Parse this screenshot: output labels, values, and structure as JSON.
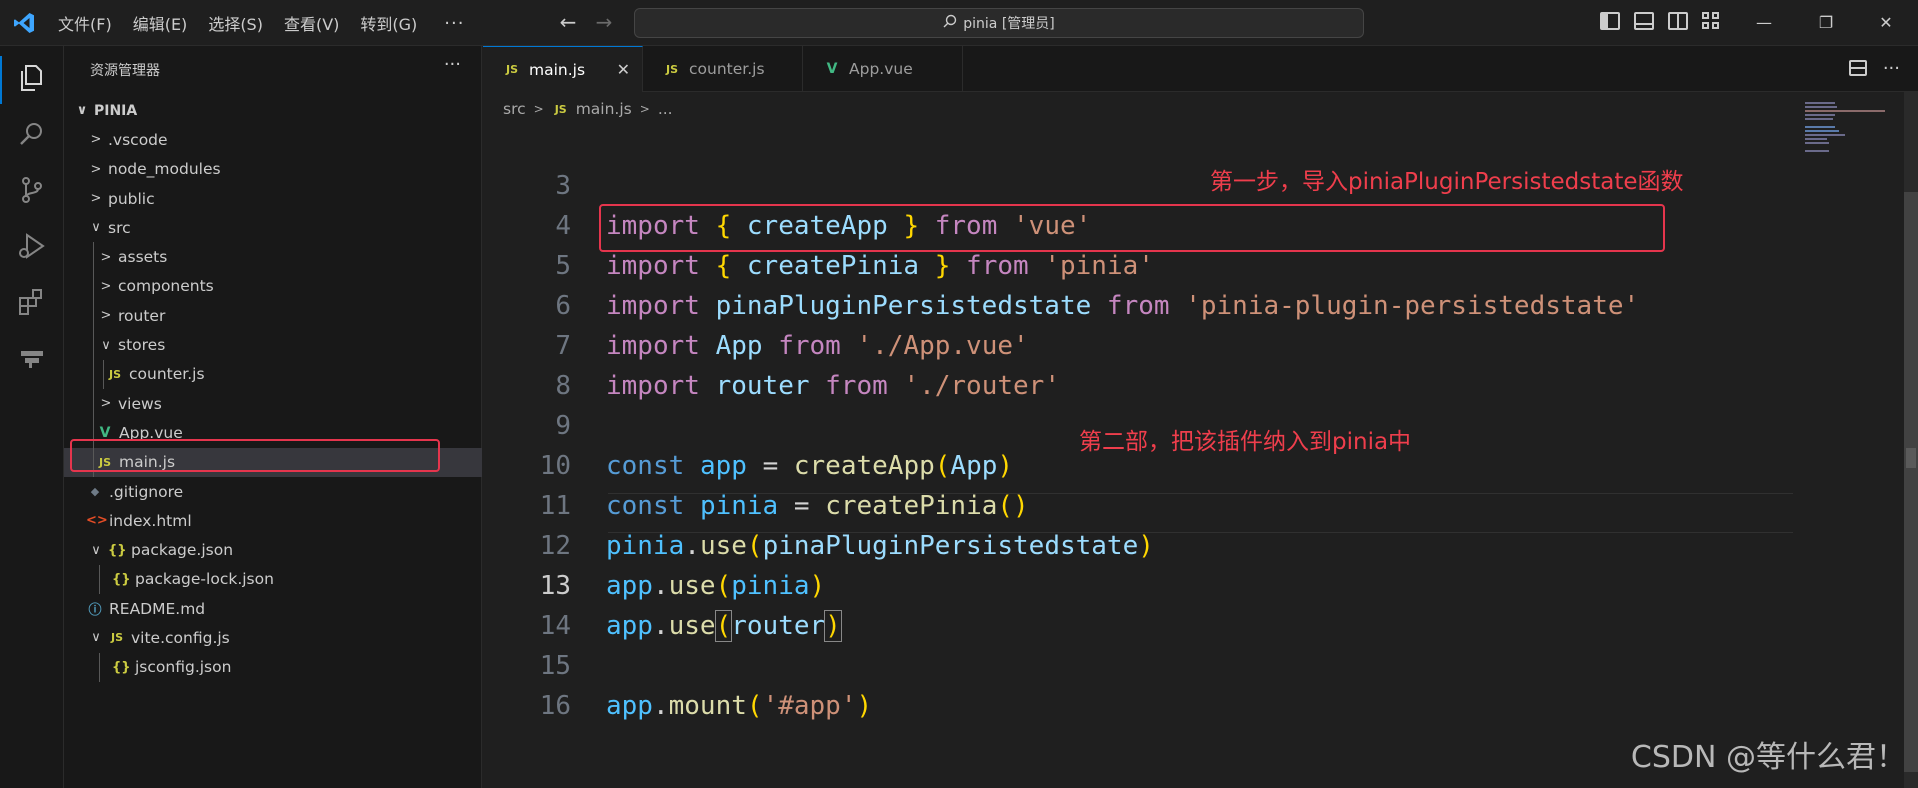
{
  "titlebar": {
    "menus": [
      "文件(F)",
      "编辑(E)",
      "选择(S)",
      "查看(V)",
      "转到(G)"
    ],
    "more": "···",
    "search_text": "pinia [管理员]",
    "back_icon": "arrow-left-icon",
    "forward_icon": "arrow-right-icon",
    "minimize": "—",
    "restore": "❐",
    "close": "✕"
  },
  "explorer": {
    "title": "资源管理器",
    "more": "···",
    "items": [
      {
        "label": "PINIA",
        "chev": "∨",
        "icon": ""
      },
      {
        "label": ".vscode",
        "chev": ">",
        "icon": ""
      },
      {
        "label": "node_modules",
        "chev": ">",
        "icon": ""
      },
      {
        "label": "public",
        "chev": ">",
        "icon": ""
      },
      {
        "label": "src",
        "chev": "∨",
        "icon": ""
      },
      {
        "label": "assets",
        "chev": ">",
        "icon": ""
      },
      {
        "label": "components",
        "chev": ">",
        "icon": ""
      },
      {
        "label": "router",
        "chev": ">",
        "icon": ""
      },
      {
        "label": "stores",
        "chev": "∨",
        "icon": ""
      },
      {
        "label": "counter.js",
        "chev": "",
        "icon": "JS"
      },
      {
        "label": "views",
        "chev": ">",
        "icon": ""
      },
      {
        "label": "App.vue",
        "chev": "",
        "icon": "V"
      },
      {
        "label": "main.js",
        "chev": "",
        "icon": "JS"
      },
      {
        "label": ".gitignore",
        "chev": "",
        "icon": "◆"
      },
      {
        "label": "index.html",
        "chev": "",
        "icon": "<>"
      },
      {
        "label": "package.json",
        "chev": "∨",
        "icon": "{}"
      },
      {
        "label": "package-lock.json",
        "chev": "",
        "icon": "{}"
      },
      {
        "label": "README.md",
        "chev": "",
        "icon": "ⓘ"
      },
      {
        "label": "vite.config.js",
        "chev": "∨",
        "icon": "JS"
      },
      {
        "label": "jsconfig.json",
        "chev": "",
        "icon": "{}"
      }
    ]
  },
  "tabs": [
    {
      "label": "main.js",
      "icon": "JS",
      "close": "✕"
    },
    {
      "label": "counter.js",
      "icon": "JS"
    },
    {
      "label": "App.vue",
      "icon": "V"
    }
  ],
  "tab_actions": {
    "more": "···"
  },
  "breadcrumb": {
    "folder": "src",
    "file": "main.js",
    "icon": "JS",
    "rest": "..."
  },
  "code": {
    "line_numbers": [
      "3",
      "4",
      "5",
      "6",
      "7",
      "8",
      "9",
      "10",
      "11",
      "12",
      "13",
      "14",
      "15",
      "16"
    ],
    "l3": {
      "a": "import",
      "b": "{",
      "c": "createApp",
      "d": "}",
      "e": "from",
      "f": "'vue'"
    },
    "l4": {
      "a": "import",
      "b": "{",
      "c": "createPinia",
      "d": "}",
      "e": "from",
      "f": "'pinia'"
    },
    "l5": {
      "a": "import",
      "c": "pinaPluginPersistedstate",
      "e": "from",
      "f": "'pinia-plugin-persistedstate'"
    },
    "l6": {
      "a": "import",
      "c": "App",
      "e": "from",
      "f": "'./App.vue'"
    },
    "l7": {
      "a": "import",
      "c": "router",
      "e": "from",
      "f": "'./router'"
    },
    "l9": {
      "a": "const",
      "b": "app",
      "c": "=",
      "d": "createApp",
      "e": "(",
      "f": "App",
      "g": ")"
    },
    "l10": {
      "a": "const",
      "b": "pinia",
      "c": "=",
      "d": "createPinia",
      "e": "()"
    },
    "l11": {
      "a": "pinia",
      "b": ".",
      "c": "use",
      "d": "(",
      "e": "pinaPluginPersistedstate",
      "f": ")"
    },
    "l12": {
      "a": "app",
      "b": ".",
      "c": "use",
      "d": "(",
      "e": "pinia",
      "f": ")"
    },
    "l13": {
      "a": "app",
      "b": ".",
      "c": "use",
      "d": "(",
      "e": "router",
      "f": ")"
    },
    "l15": {
      "a": "app",
      "b": ".",
      "c": "mount",
      "d": "(",
      "e": "'#app'",
      "f": ")"
    }
  },
  "annotations": {
    "step1": "第一步，导入piniaPluginPersistedstate函数",
    "step2": "第二部，把该插件纳入到pinia中"
  },
  "watermark": "CSDN @等什么君！",
  "colors": {
    "accent": "#0078d4",
    "annotation": "#ef3e4c"
  }
}
